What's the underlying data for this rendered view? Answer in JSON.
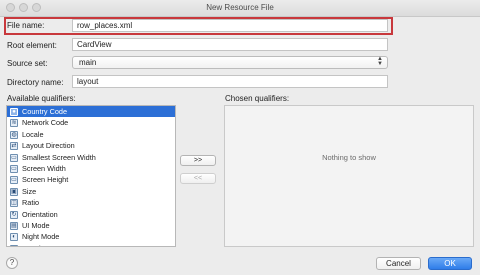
{
  "window": {
    "title": "New Resource File"
  },
  "form": {
    "file_name_label": "File name:",
    "file_name_value": "row_places.xml",
    "root_element_label": "Root element:",
    "root_element_value": "CardView",
    "source_set_label": "Source set:",
    "source_set_value": "main",
    "directory_label": "Directory name:",
    "directory_value": "layout"
  },
  "qualifiers": {
    "available_label": "Available qualifiers:",
    "chosen_label": "Chosen qualifiers:",
    "items": [
      {
        "label": "Country Code",
        "icon": "globe-icon"
      },
      {
        "label": "Network Code",
        "icon": "network-icon"
      },
      {
        "label": "Locale",
        "icon": "locale-icon"
      },
      {
        "label": "Layout Direction",
        "icon": "layout-direction-icon"
      },
      {
        "label": "Smallest Screen Width",
        "icon": "screen-icon"
      },
      {
        "label": "Screen Width",
        "icon": "screen-icon"
      },
      {
        "label": "Screen Height",
        "icon": "screen-icon"
      },
      {
        "label": "Size",
        "icon": "size-icon"
      },
      {
        "label": "Ratio",
        "icon": "ratio-icon"
      },
      {
        "label": "Orientation",
        "icon": "orientation-icon"
      },
      {
        "label": "UI Mode",
        "icon": "ui-mode-icon"
      },
      {
        "label": "Night Mode",
        "icon": "night-mode-icon"
      },
      {
        "label": "Density",
        "icon": "density-icon"
      }
    ],
    "selected_index": 0,
    "add_button": ">>",
    "remove_button": "<<",
    "empty_text": "Nothing to show"
  },
  "footer": {
    "help": "?",
    "cancel": "Cancel",
    "ok": "OK"
  },
  "colors": {
    "selection": "#2c6fd6",
    "highlight_border": "#c8383c",
    "ok_button": "#2f7de9"
  }
}
